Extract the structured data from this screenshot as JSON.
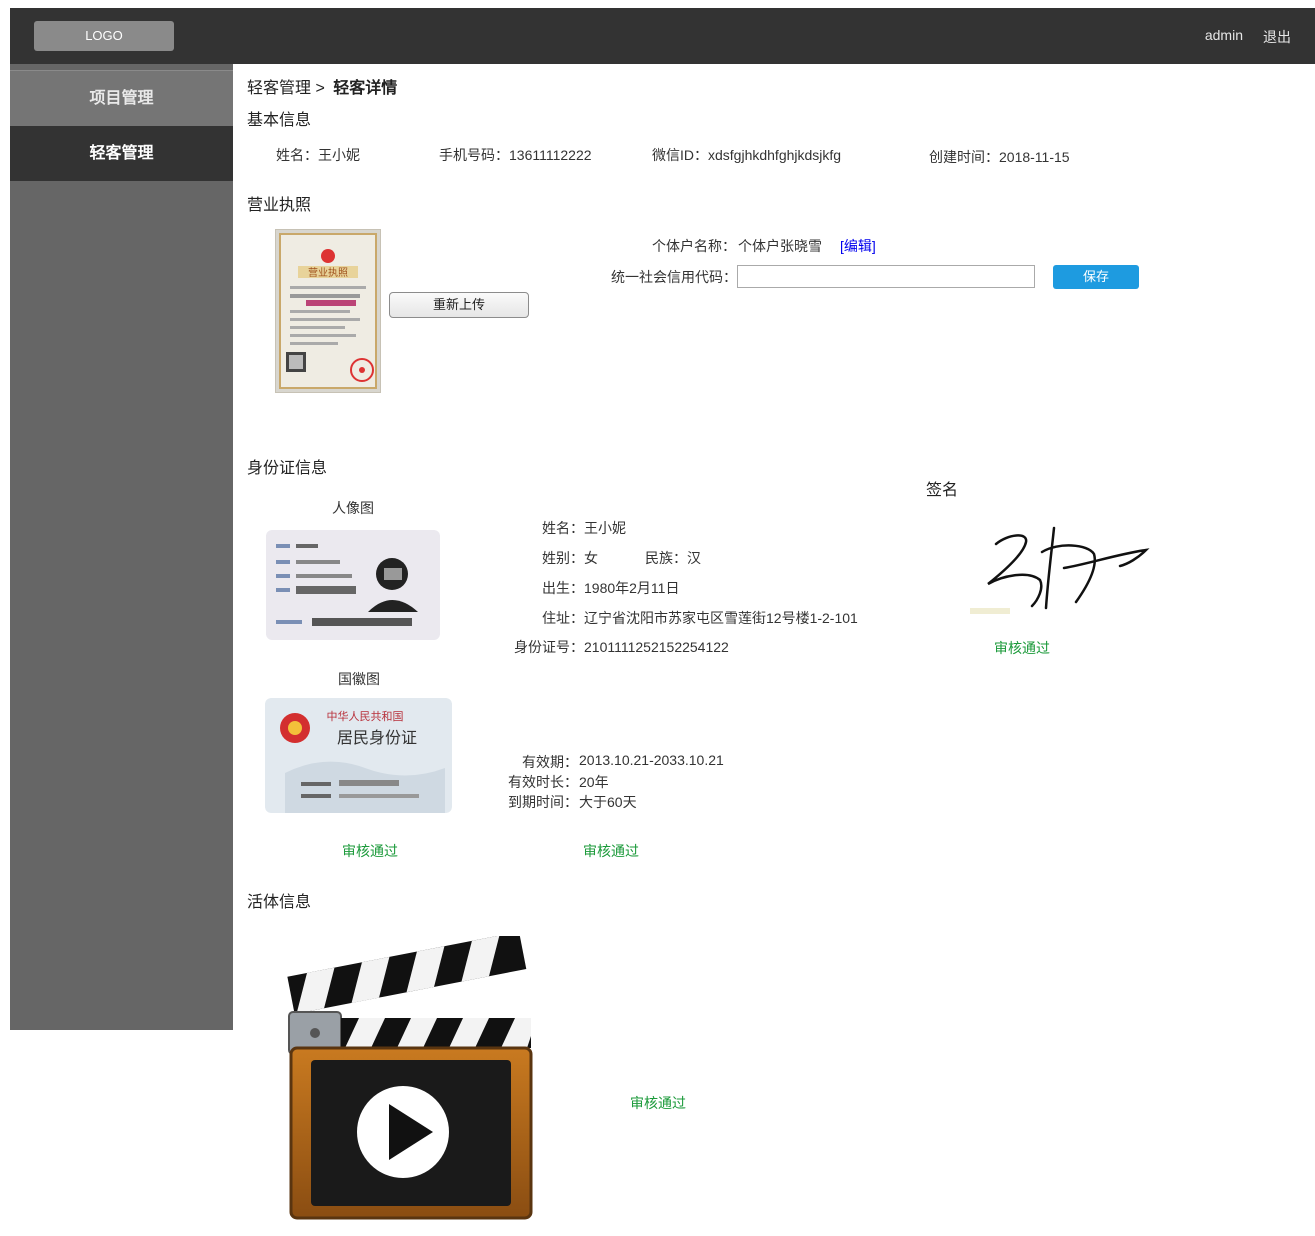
{
  "header": {
    "logo": "LOGO",
    "user": "admin",
    "logout": "退出"
  },
  "sidebar": {
    "items": [
      {
        "label": "项目管理"
      },
      {
        "label": "轻客管理"
      }
    ]
  },
  "breadcrumb": {
    "parent": "轻客管理 >",
    "current": "轻客详情"
  },
  "basic": {
    "title": "基本信息",
    "name": "姓名：王小妮",
    "phone": "手机号码：13611112222",
    "wechat": "微信ID：xdsfgjhkdhfghjkdsjkfg",
    "created": "创建时间：2018-11-15"
  },
  "license": {
    "title": "营业执照",
    "image_title": "营业执照",
    "reupload": "重新上传",
    "name_label": "个体户名称：",
    "name_value": "个体户张晓雪",
    "edit": "[编辑]",
    "code_label": "统一社会信用代码：",
    "code_value": "",
    "save": "保存"
  },
  "idcard": {
    "title": "身份证信息",
    "portrait_label": "人像图",
    "emblem_label": "国徽图",
    "card_country": "中华人民共和国",
    "card_title": "居民身份证",
    "name": "姓名：王小妮",
    "gender": "姓别：女",
    "ethnic": "民族：汉",
    "birth": "出生：1980年2月11日",
    "address": "住址：辽宁省沈阳市苏家屯区雪莲街12号楼1-2-101",
    "id_no": "身份证号：2101111252152254122",
    "valid_label": "有效期：",
    "valid_value": "2013.10.21-2033.10.21",
    "duration_label": "有效时长：",
    "duration_value": "20年",
    "expire_label": "到期时间：",
    "expire_value": "大于60天",
    "status_images": "审核通过",
    "status_info": "审核通过"
  },
  "signature": {
    "title": "签名",
    "status": "审核通过"
  },
  "liveness": {
    "title": "活体信息",
    "status": "审核通过"
  },
  "colors": {
    "header": "#333333",
    "sidebar": "#666666",
    "active": "#333333",
    "accent": "#1e9be0",
    "pass": "#1b9a3a",
    "edit": "#0000ee"
  }
}
